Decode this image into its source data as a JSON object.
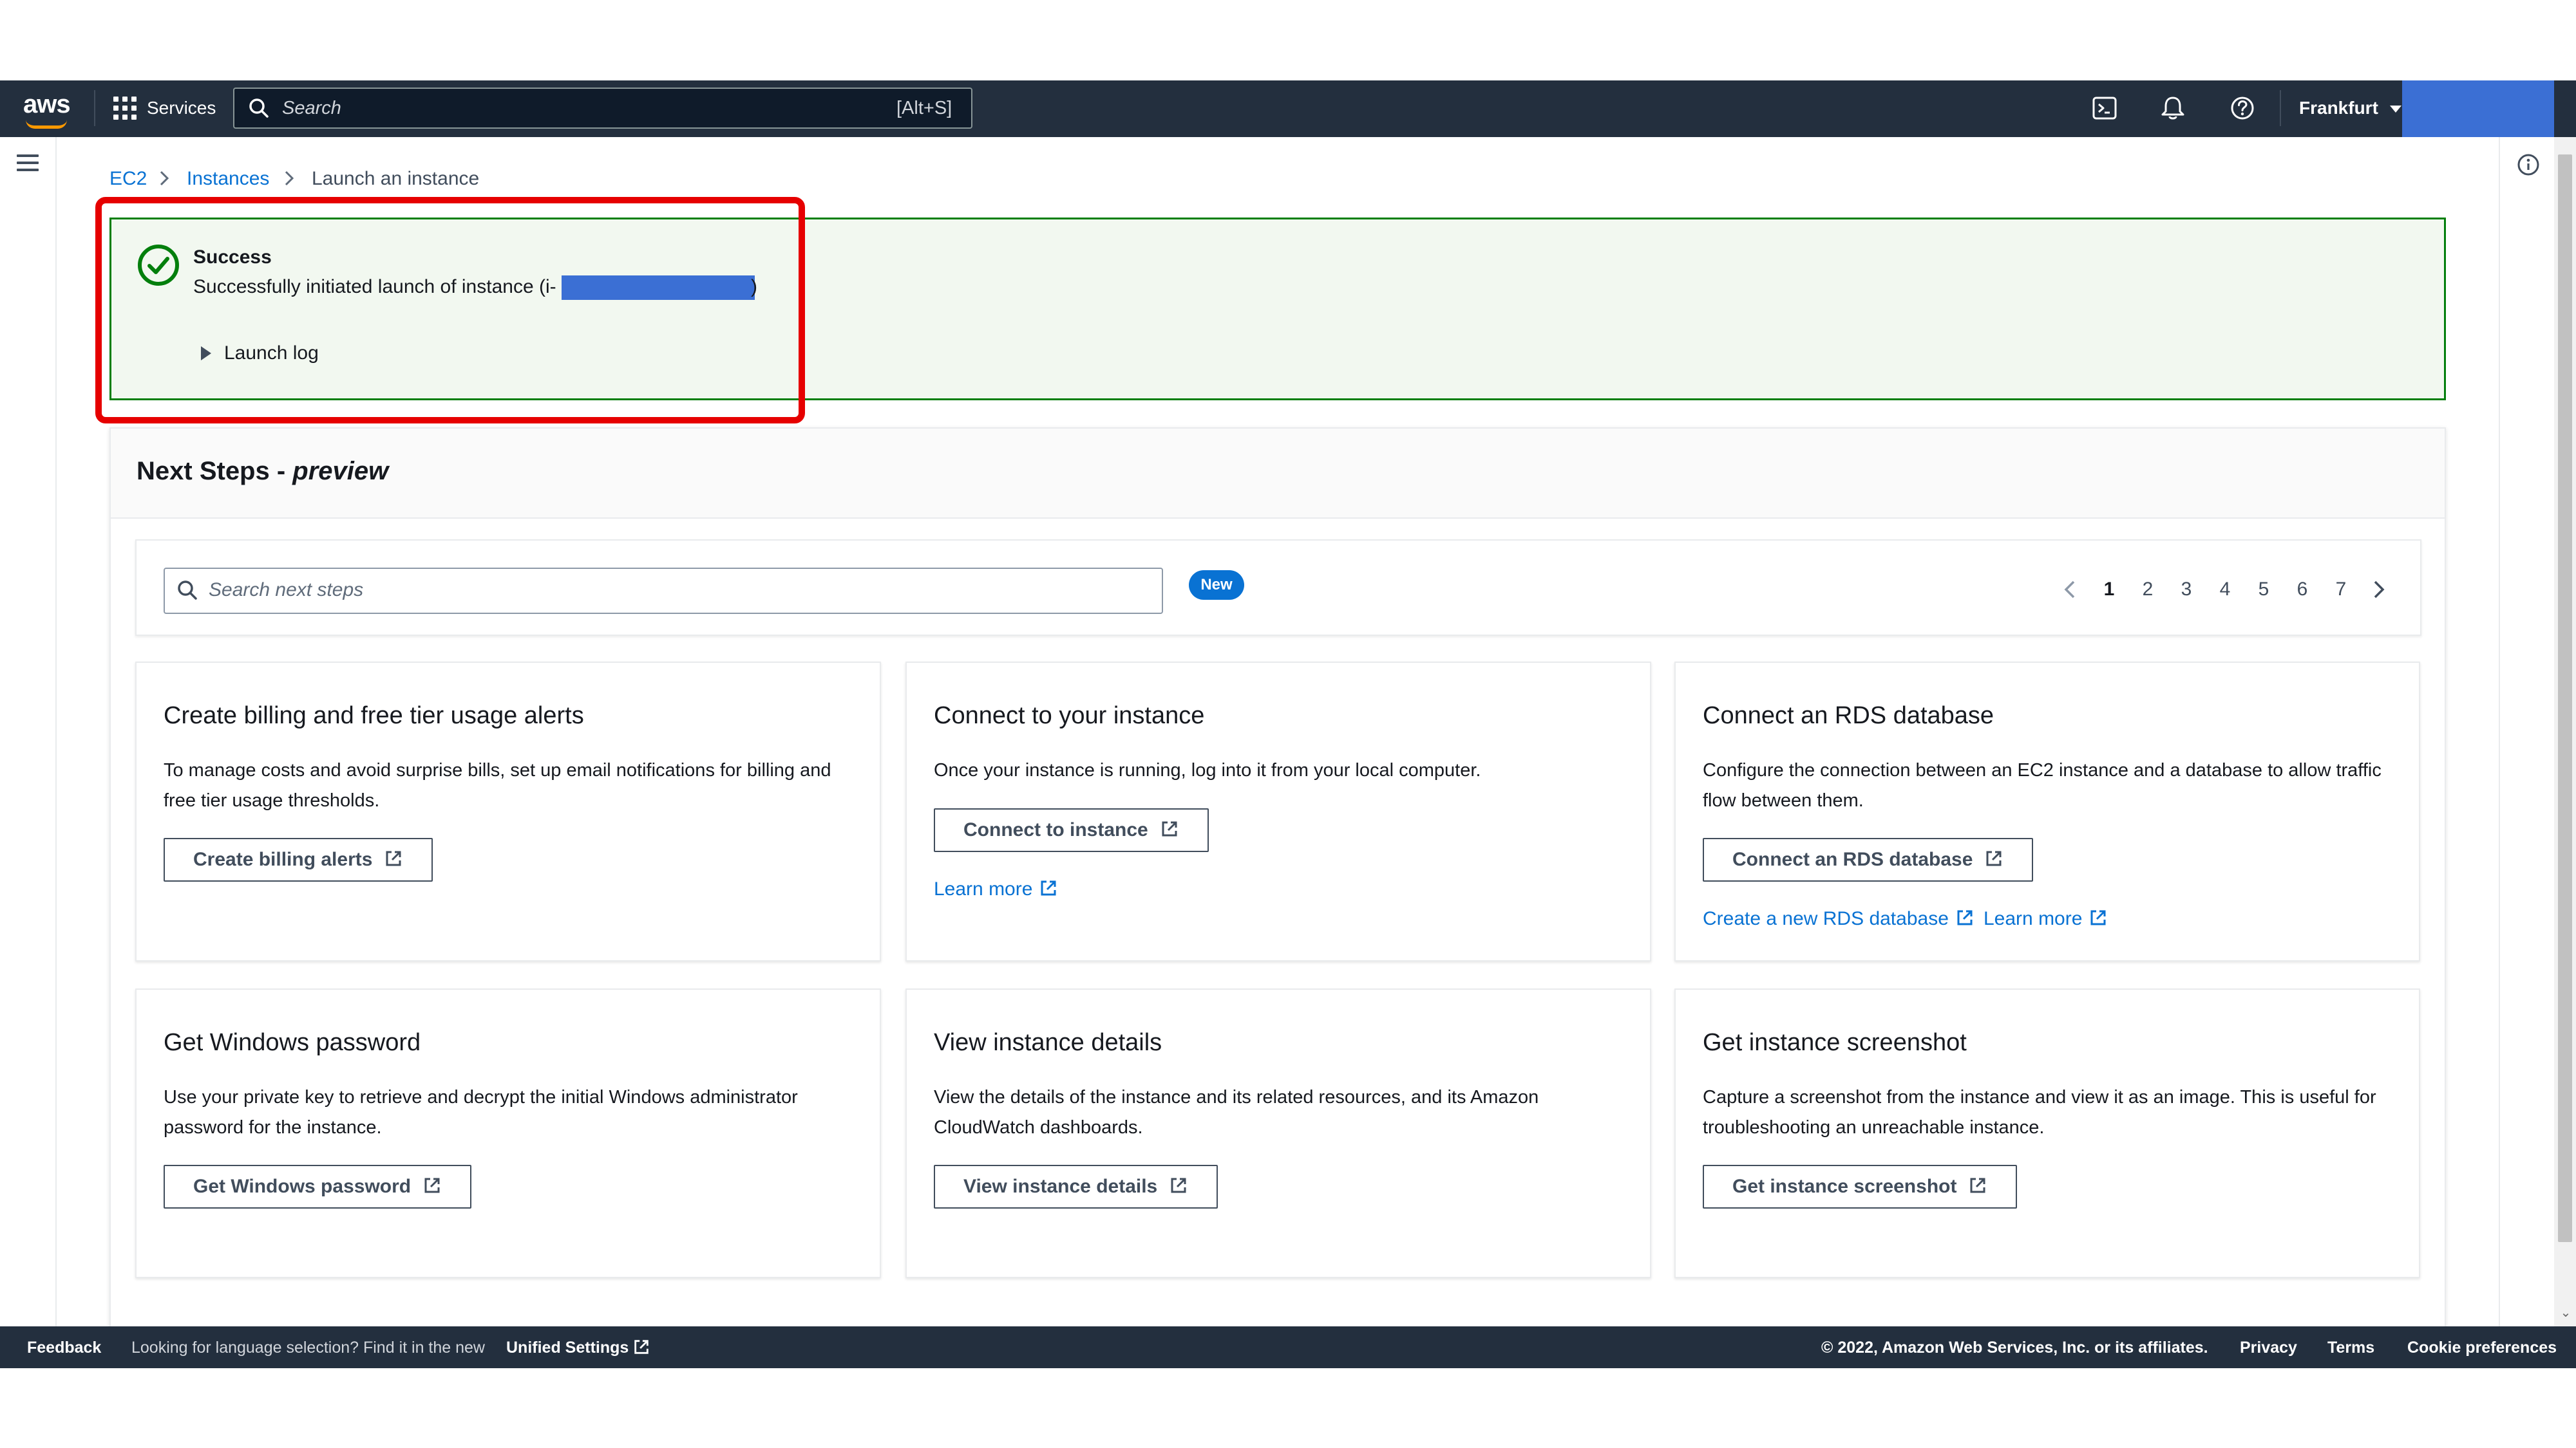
{
  "topnav": {
    "logo_text": "aws",
    "services_label": "Services",
    "search_placeholder": "Search",
    "search_shortcut": "[Alt+S]",
    "region": "Frankfurt",
    "icons": [
      "grid-icon",
      "search-icon",
      "cloudshell-icon",
      "bell-icon",
      "help-icon",
      "caret-down-icon"
    ]
  },
  "breadcrumb": {
    "items": [
      "EC2",
      "Instances",
      "Launch an instance"
    ]
  },
  "flash": {
    "title": "Success",
    "message": "Successfully initiated launch of instance (i-",
    "message_end": ")",
    "expander_label": "Launch log",
    "color": "#037f0c"
  },
  "next_steps": {
    "title": "Next Steps - ",
    "title_suffix": "preview",
    "search_placeholder": "Search next steps",
    "badge": "New",
    "pagination": [
      "1",
      "2",
      "3",
      "4",
      "5",
      "6",
      "7"
    ],
    "current_page": "1"
  },
  "cards": [
    {
      "title": "Create billing and free tier usage alerts",
      "desc": "To manage costs and avoid surprise bills, set up email notifications for billing and free tier usage thresholds.",
      "button": "Create billing alerts"
    },
    {
      "title": "Connect to your instance",
      "desc": "Once your instance is running, log into it from your local computer.",
      "button": "Connect to instance",
      "link": "Learn more"
    },
    {
      "title": "Connect an RDS database",
      "desc": "Configure the connection between an EC2 instance and a database to allow traffic flow between them.",
      "button": "Connect an RDS database",
      "link": "Create a new RDS database",
      "link2": "Learn more"
    },
    {
      "title": "Get Windows password",
      "desc": "Use your private key to retrieve and decrypt the initial Windows administrator password for the instance.",
      "button": "Get Windows password"
    },
    {
      "title": "View instance details",
      "desc": "View the details of the instance and its related resources, and its Amazon CloudWatch dashboards.",
      "button": "View instance details"
    },
    {
      "title": "Get instance screenshot",
      "desc": "Capture a screenshot from the instance and view it as an image. This is useful for troubleshooting an unreachable instance.",
      "button": "Get instance screenshot"
    }
  ],
  "footer": {
    "feedback": "Feedback",
    "language_note": "Looking for language selection? Find it in the new",
    "unified_settings": "Unified Settings",
    "copyright": "© 2022, Amazon Web Services, Inc. or its affiliates.",
    "privacy": "Privacy",
    "terms": "Terms",
    "cookies": "Cookie preferences"
  },
  "colors": {
    "nav_bg": "#232f3e",
    "link": "#0972d3",
    "success": "#037f0c",
    "highlight": "#e60000",
    "redaction": "#3b6fd4"
  }
}
